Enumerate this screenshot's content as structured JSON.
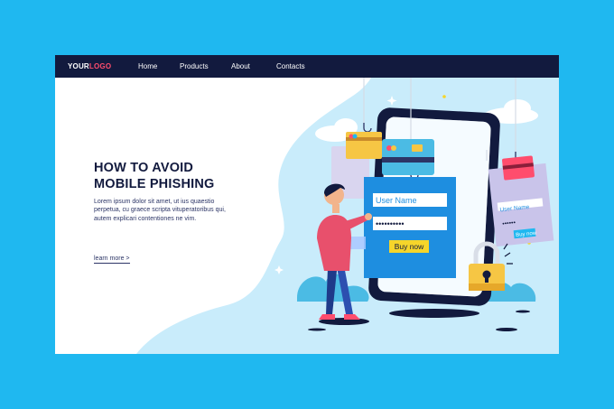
{
  "nav": {
    "logo_main": "YOUR",
    "logo_accent": "LOGO",
    "items": [
      {
        "label": "Home"
      },
      {
        "label": "Products"
      },
      {
        "label": "About"
      },
      {
        "label": "Contacts"
      }
    ]
  },
  "hero": {
    "title_line1": "HOW TO AVOID",
    "title_line2": "MOBILE PHISHING",
    "body": "Lorem ipsum dolor sit amet, ut ius quaestio perpetua, cu graece scripta vituperatoribus qui, autem explicari contentiones ne vim.",
    "cta": "learn more >"
  },
  "phone_form": {
    "username_placeholder": "User Name",
    "password_mask": "••••••••••",
    "button": "Buy now"
  },
  "side_card": {
    "username_placeholder": "User Name",
    "password_mask": "••••••",
    "button": "Buy now"
  },
  "colors": {
    "background": "#1fb8f0",
    "nav": "#121a3e",
    "accent": "#ff4d6d",
    "blob": "#c9ecfb"
  }
}
